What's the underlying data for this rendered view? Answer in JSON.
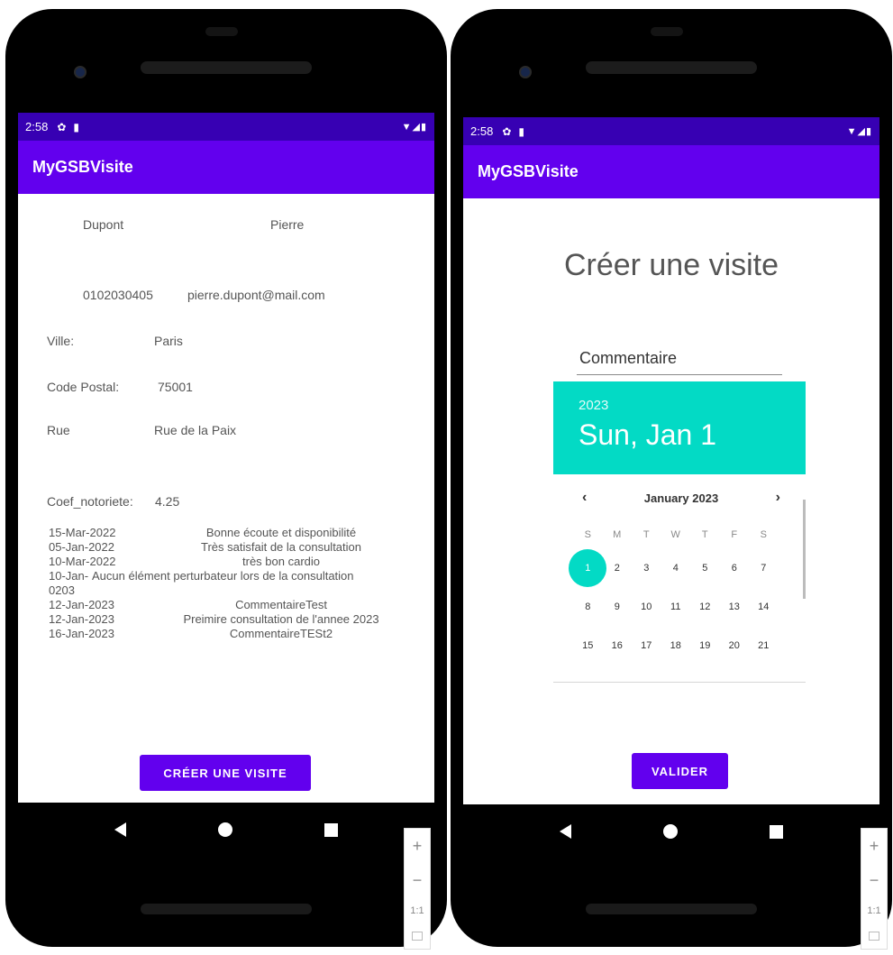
{
  "left_screen": {
    "status_bar": {
      "time": "2:58"
    },
    "app_title": "MyGSBVisite",
    "contact": {
      "last_name": "Dupont",
      "first_name": "Pierre",
      "phone": "0102030405",
      "email": "pierre.dupont@mail.com"
    },
    "fields": {
      "ville_label": "Ville:",
      "ville_value": "Paris",
      "code_postal_label": "Code Postal:",
      "code_postal_value": "75001",
      "rue_label": "Rue",
      "rue_value": "Rue de la Paix",
      "coef_label": "Coef_notoriete:",
      "coef_value": "4.25"
    },
    "visits": [
      {
        "date": "15-Mar-2022",
        "comment": "Bonne écoute et disponibilité"
      },
      {
        "date": "05-Jan-2022",
        "comment": "Très satisfait de la consultation"
      },
      {
        "date": "10-Mar-2022",
        "comment": "très bon cardio"
      },
      {
        "date": "10-Jan-0203",
        "comment": "Aucun élément perturbateur lors de la consultation"
      },
      {
        "date": "12-Jan-2023",
        "comment": "CommentaireTest"
      },
      {
        "date": "12-Jan-2023",
        "comment": "Preimire consultation de l'annee 2023"
      },
      {
        "date": "16-Jan-2023",
        "comment": "CommentaireTESt2"
      }
    ],
    "create_button": "CRÉER UNE VISITE"
  },
  "right_screen": {
    "status_bar": {
      "time": "2:58"
    },
    "app_title": "MyGSBVisite",
    "form_title": "Créer une visite",
    "comment_placeholder": "Commentaire",
    "date_picker": {
      "year": "2023",
      "selected_date": "Sun, Jan 1",
      "month_label": "January 2023",
      "prev_arrow": "‹",
      "next_arrow": "›",
      "weekdays": [
        "S",
        "M",
        "T",
        "W",
        "T",
        "F",
        "S"
      ],
      "days": [
        "1",
        "2",
        "3",
        "4",
        "5",
        "6",
        "7",
        "8",
        "9",
        "10",
        "11",
        "12",
        "13",
        "14",
        "15",
        "16",
        "17",
        "18",
        "19",
        "20",
        "21"
      ],
      "selected_day": "1"
    },
    "validate_button": "VALIDER"
  },
  "zoom_controls": {
    "plus": "+",
    "minus": "−",
    "one_to_one": "1:1"
  },
  "colors": {
    "primary": "#6200ee",
    "primary_dark": "#3700b3",
    "accent": "#03dac5"
  }
}
